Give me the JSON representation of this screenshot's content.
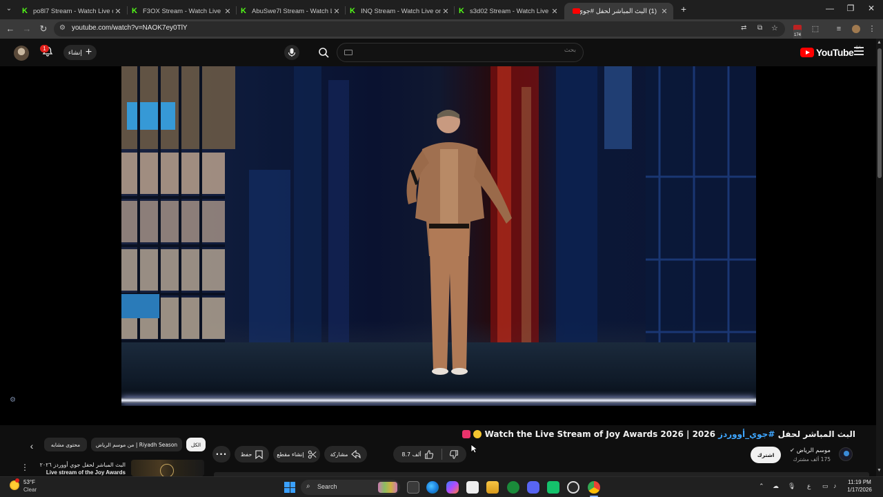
{
  "browser": {
    "tabs": [
      {
        "title": "po8l7 Stream - Watch Live on K",
        "favicon": "kick-icon",
        "active": false
      },
      {
        "title": "F3OX Stream - Watch Live on K",
        "favicon": "kick-icon",
        "active": false
      },
      {
        "title": "AbuSwe7l Stream - Watch Live",
        "favicon": "kick-icon",
        "active": false
      },
      {
        "title": "INQ Stream - Watch Live on Ki",
        "favicon": "kick-icon",
        "active": false
      },
      {
        "title": "s3d02 Stream - Watch Live on K",
        "favicon": "kick-icon",
        "active": false
      },
      {
        "title": "(1) البث المباشر لحفل #جوي",
        "favicon": "youtube-icon",
        "active": true
      }
    ],
    "url": "youtube.com/watch?v=NAOK7ey0TlY",
    "extension_badge": "174"
  },
  "masthead": {
    "notification_count": "1",
    "create_label": "إنشاء",
    "search_placeholder": "بحث",
    "logo_text": "YouTube",
    "country_code": "SA"
  },
  "video": {
    "title_prefix": "البث المباشر لحفل",
    "title_hashtag": "#جوي_أووردز",
    "title_main": "2026 | Watch the Live Stream of Joy Awards 2026",
    "channel_name": "موسم الرياض",
    "subscriber_count": "175 ألف مشترك",
    "subscribe_label": "اشترك",
    "like_count": "8.7 ألف",
    "share_label": "مشاركة",
    "clip_label": "إنشاء مقطع",
    "save_label": "حفظ",
    "more_label": "..."
  },
  "chips": [
    {
      "label": "الكل",
      "active": true
    },
    {
      "label": "من موسم الرياض | Riyadh Season",
      "active": false
    },
    {
      "label": "محتوى مشابه",
      "active": false
    }
  ],
  "recommendation": {
    "title_line1": "البث المباشر لحفل جوي أووردز ٢٠٢٦",
    "title_line2": "Live stream of the Joy Awards"
  },
  "taskbar": {
    "weather_temp": "53°F",
    "weather_desc": "Clear",
    "search_label": "Search",
    "time": "11:19 PM",
    "date": "1/17/2026",
    "language": "ع"
  },
  "colors": {
    "youtube_red": "#ff0000",
    "kick_green": "#53fc18",
    "link_blue": "#3ea6ff",
    "background": "#0f0f0f"
  }
}
